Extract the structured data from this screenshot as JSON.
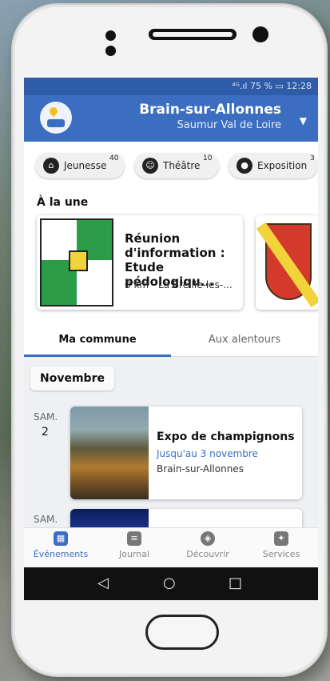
{
  "status": {
    "text": "⁴ᴳ.ıl 75 % ▭ 12:28"
  },
  "header": {
    "town": "Brain-sur-Allonnes",
    "area": "Saumur Val de Loire"
  },
  "chips": [
    {
      "label": "Jeunesse",
      "count": "40",
      "icon": "museum-icon"
    },
    {
      "label": "Théâtre",
      "count": "10",
      "icon": "theater-masks-icon"
    },
    {
      "label": "Exposition",
      "count": "3",
      "icon": "palette-icon"
    }
  ],
  "featured": {
    "title": "À la une",
    "card": {
      "title": "Réunion d'information : Etude pédologiqu...",
      "subtitle": "0 km - La Breille-les-..."
    }
  },
  "tabs": {
    "active": "Ma commune",
    "inactive": "Aux alentours"
  },
  "feed": {
    "month": "Novembre",
    "event1": {
      "day_name": "SAM.",
      "day_num": "2",
      "title": "Expo de champignons",
      "date": "Jusqu'au 3 novembre",
      "place": "Brain-sur-Allonnes"
    },
    "event2": {
      "day_name": "SAM."
    }
  },
  "bottom_nav": [
    {
      "label": "Événements",
      "icon": "calendar-icon",
      "active": true
    },
    {
      "label": "Journal",
      "icon": "newspaper-icon",
      "active": false
    },
    {
      "label": "Découvrir",
      "icon": "compass-icon",
      "active": false
    },
    {
      "label": "Services",
      "icon": "services-icon",
      "active": false
    }
  ],
  "colors": {
    "primary": "#3b6ec0",
    "statusbar": "#2e5ca8"
  }
}
